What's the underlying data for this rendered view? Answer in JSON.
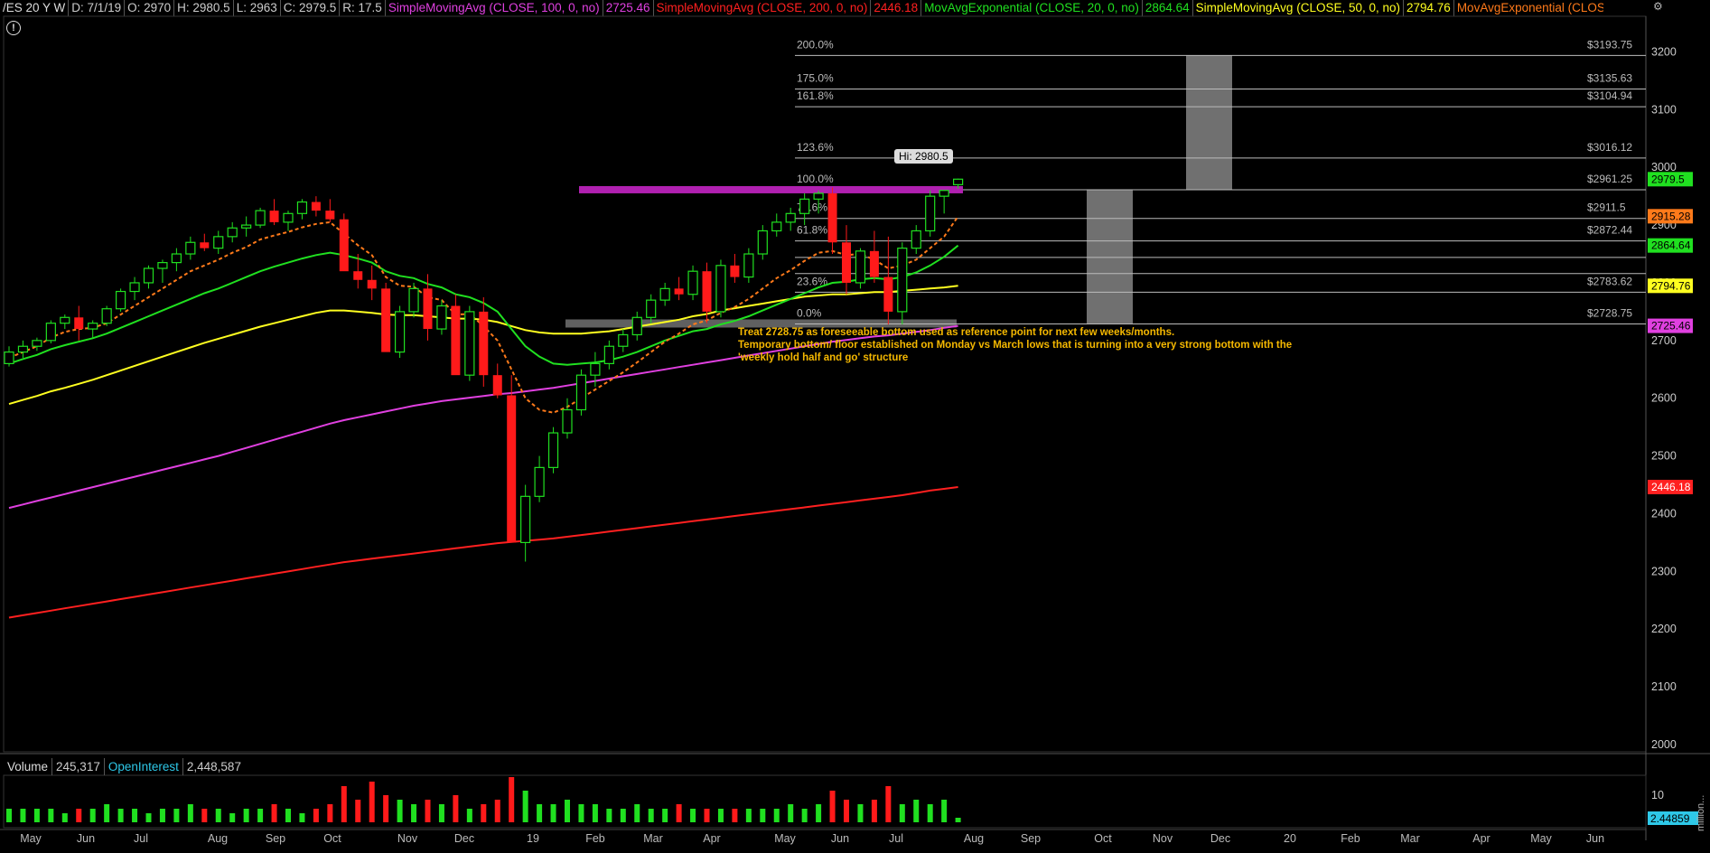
{
  "header": {
    "symbol": "/ES 20 Y W",
    "date": "D: 7/1/19",
    "open": "O: 2970",
    "high": "H: 2980.5",
    "low": "L: 2963",
    "close": "C: 2979.5",
    "range": "R: 17.5",
    "studies": [
      {
        "label": "SimpleMovingAvg (CLOSE, 100, 0, no)",
        "value": "2725.46",
        "color": "#e040e0"
      },
      {
        "label": "SimpleMovingAvg (CLOSE, 200, 0, no)",
        "value": "2446.18",
        "color": "#ff2020"
      },
      {
        "label": "MovAvgExponential (CLOSE, 20, 0, no)",
        "value": "2864.64",
        "color": "#20e020"
      },
      {
        "label": "SimpleMovingAvg (CLOSE, 50, 0, no)",
        "value": "2794.76",
        "color": "#ffff20"
      },
      {
        "label": "MovAvgExponential (CLOSE, 8, 0, no)",
        "value": "2915.28",
        "color": "#ff7a1a"
      }
    ],
    "more": "..."
  },
  "info_icon": "!",
  "corner_icon": "gear-icon",
  "price_axis_labels": [
    "3200",
    "3100",
    "3000",
    "2900",
    "2800",
    "2700",
    "2600",
    "2500",
    "2400",
    "2300",
    "2200",
    "2100",
    "2000"
  ],
  "price_badges": [
    {
      "value": "2979.5",
      "bg": "#20e020",
      "fg": "#000"
    },
    {
      "value": "2915.28",
      "bg": "#ff7a1a",
      "fg": "#000"
    },
    {
      "value": "2864.64",
      "bg": "#20e020",
      "fg": "#000"
    },
    {
      "value": "2794.76",
      "bg": "#ffff20",
      "fg": "#000"
    },
    {
      "value": "2725.46",
      "bg": "#e040e0",
      "fg": "#000"
    },
    {
      "value": "2446.18",
      "bg": "#ff2020",
      "fg": "#fff"
    }
  ],
  "fib_levels": [
    {
      "pct": "200.0%",
      "price": "$3193.75",
      "value": 3193.75
    },
    {
      "pct": "175.0%",
      "price": "$3135.63",
      "value": 3135.63
    },
    {
      "pct": "161.8%",
      "price": "$3104.94",
      "value": 3104.94
    },
    {
      "pct": "123.6%",
      "price": "$3016.12",
      "value": 3016.12
    },
    {
      "pct": "100.0%",
      "price": "$2961.25",
      "value": 2961.25
    },
    {
      "pct": "78.6%",
      "price": "$2911.5",
      "value": 2911.5
    },
    {
      "pct": "61.8%",
      "price": "$2872.44",
      "value": 2872.44
    },
    {
      "pct": "",
      "price": "",
      "value": 2844
    },
    {
      "pct": "",
      "price": "",
      "value": 2816
    },
    {
      "pct": "23.6%",
      "price": "$2783.62",
      "value": 2783.62
    },
    {
      "pct": "0.0%",
      "price": "$2728.75",
      "value": 2728.75
    }
  ],
  "hi_label": "Hi: 2980.5",
  "annotation": "Treat 2728.75 as foreseeable bottom used as reference point for next few weeks/months.\nTemporary bottom/ floor established on Monday vs March lows that is turning into a very strong bottom with the\n'weekly hold half and go' structure",
  "x_axis_labels": [
    "May",
    "Jun",
    "Jul",
    "Aug",
    "Sep",
    "Oct",
    "Nov",
    "Dec",
    "19",
    "Feb",
    "Mar",
    "Apr",
    "May",
    "Jun",
    "Jul",
    "Aug",
    "Sep",
    "Oct",
    "Nov",
    "Dec",
    "20",
    "Feb",
    "Mar",
    "Apr",
    "May",
    "Jun"
  ],
  "volume": {
    "label": "Volume",
    "value": "245,317",
    "oi_label": "OpenInterest",
    "oi_value": "2,448,587",
    "axis_label": "10",
    "badge": "2.44859",
    "units": "million..."
  },
  "chart_data": {
    "type": "candlestick",
    "bars": [
      [
        2660,
        2690,
        2655,
        2680
      ],
      [
        2680,
        2700,
        2670,
        2690
      ],
      [
        2690,
        2705,
        2682,
        2700
      ],
      [
        2700,
        2735,
        2695,
        2730
      ],
      [
        2730,
        2745,
        2720,
        2740
      ],
      [
        2740,
        2760,
        2700,
        2720
      ],
      [
        2720,
        2735,
        2705,
        2730
      ],
      [
        2730,
        2760,
        2725,
        2755
      ],
      [
        2755,
        2790,
        2750,
        2785
      ],
      [
        2785,
        2810,
        2770,
        2800
      ],
      [
        2800,
        2830,
        2790,
        2825
      ],
      [
        2825,
        2840,
        2800,
        2835
      ],
      [
        2835,
        2860,
        2820,
        2850
      ],
      [
        2850,
        2880,
        2840,
        2870
      ],
      [
        2870,
        2885,
        2855,
        2860
      ],
      [
        2860,
        2890,
        2850,
        2880
      ],
      [
        2880,
        2905,
        2870,
        2895
      ],
      [
        2895,
        2915,
        2880,
        2900
      ],
      [
        2900,
        2930,
        2895,
        2925
      ],
      [
        2925,
        2945,
        2900,
        2905
      ],
      [
        2905,
        2925,
        2890,
        2920
      ],
      [
        2920,
        2945,
        2910,
        2940
      ],
      [
        2940,
        2950,
        2915,
        2925
      ],
      [
        2925,
        2945,
        2905,
        2910
      ],
      [
        2910,
        2920,
        2850,
        2820
      ],
      [
        2820,
        2850,
        2790,
        2805
      ],
      [
        2805,
        2830,
        2770,
        2790
      ],
      [
        2790,
        2800,
        2740,
        2680
      ],
      [
        2680,
        2760,
        2670,
        2750
      ],
      [
        2750,
        2800,
        2740,
        2790
      ],
      [
        2790,
        2815,
        2700,
        2720
      ],
      [
        2720,
        2770,
        2710,
        2760
      ],
      [
        2760,
        2780,
        2680,
        2640
      ],
      [
        2640,
        2760,
        2630,
        2750
      ],
      [
        2750,
        2775,
        2620,
        2640
      ],
      [
        2640,
        2660,
        2600,
        2605
      ],
      [
        2605,
        2640,
        2500,
        2350
      ],
      [
        2350,
        2450,
        2317,
        2430
      ],
      [
        2430,
        2500,
        2420,
        2480
      ],
      [
        2480,
        2550,
        2470,
        2540
      ],
      [
        2540,
        2600,
        2530,
        2580
      ],
      [
        2580,
        2650,
        2570,
        2640
      ],
      [
        2640,
        2680,
        2620,
        2660
      ],
      [
        2660,
        2700,
        2650,
        2690
      ],
      [
        2690,
        2720,
        2680,
        2710
      ],
      [
        2710,
        2750,
        2700,
        2740
      ],
      [
        2740,
        2780,
        2730,
        2770
      ],
      [
        2770,
        2800,
        2760,
        2790
      ],
      [
        2790,
        2810,
        2770,
        2780
      ],
      [
        2780,
        2830,
        2770,
        2820
      ],
      [
        2820,
        2835,
        2730,
        2750
      ],
      [
        2750,
        2840,
        2740,
        2830
      ],
      [
        2830,
        2850,
        2800,
        2810
      ],
      [
        2810,
        2860,
        2800,
        2850
      ],
      [
        2850,
        2900,
        2840,
        2890
      ],
      [
        2890,
        2920,
        2880,
        2905
      ],
      [
        2905,
        2930,
        2890,
        2920
      ],
      [
        2920,
        2955,
        2900,
        2945
      ],
      [
        2945,
        2960,
        2920,
        2955
      ],
      [
        2955,
        2965,
        2850,
        2870
      ],
      [
        2870,
        2900,
        2780,
        2800
      ],
      [
        2800,
        2860,
        2790,
        2855
      ],
      [
        2855,
        2890,
        2800,
        2810
      ],
      [
        2810,
        2880,
        2728,
        2750
      ],
      [
        2750,
        2870,
        2728,
        2860
      ],
      [
        2860,
        2900,
        2850,
        2890
      ],
      [
        2890,
        2960,
        2880,
        2950
      ],
      [
        2950,
        2960,
        2920,
        2960
      ],
      [
        2970,
        2980.5,
        2963,
        2979.5
      ]
    ],
    "ema8": [
      2670,
      2680,
      2690,
      2705,
      2715,
      2720,
      2722,
      2730,
      2745,
      2760,
      2775,
      2790,
      2805,
      2820,
      2830,
      2840,
      2852,
      2862,
      2875,
      2882,
      2888,
      2896,
      2902,
      2905,
      2885,
      2865,
      2848,
      2810,
      2795,
      2793,
      2775,
      2770,
      2745,
      2746,
      2725,
      2700,
      2650,
      2600,
      2580,
      2575,
      2585,
      2600,
      2615,
      2630,
      2645,
      2662,
      2680,
      2698,
      2712,
      2728,
      2735,
      2748,
      2758,
      2772,
      2790,
      2808,
      2822,
      2838,
      2852,
      2855,
      2848,
      2850,
      2840,
      2825,
      2830,
      2840,
      2860,
      2880,
      2915
    ],
    "ema20": [
      2660,
      2668,
      2675,
      2685,
      2692,
      2698,
      2704,
      2712,
      2722,
      2732,
      2742,
      2752,
      2762,
      2772,
      2782,
      2790,
      2800,
      2810,
      2820,
      2828,
      2835,
      2842,
      2848,
      2852,
      2848,
      2842,
      2835,
      2820,
      2812,
      2808,
      2798,
      2792,
      2780,
      2775,
      2765,
      2750,
      2720,
      2690,
      2672,
      2660,
      2658,
      2660,
      2662,
      2666,
      2672,
      2680,
      2690,
      2700,
      2708,
      2716,
      2720,
      2728,
      2734,
      2742,
      2752,
      2762,
      2772,
      2782,
      2792,
      2800,
      2802,
      2806,
      2808,
      2806,
      2810,
      2818,
      2830,
      2845,
      2864.64
    ],
    "sma50": [
      2590,
      2597,
      2604,
      2612,
      2618,
      2625,
      2632,
      2640,
      2648,
      2656,
      2664,
      2672,
      2680,
      2688,
      2696,
      2703,
      2710,
      2717,
      2724,
      2730,
      2736,
      2742,
      2748,
      2752,
      2752,
      2750,
      2748,
      2745,
      2744,
      2744,
      2742,
      2740,
      2738,
      2738,
      2736,
      2732,
      2725,
      2718,
      2714,
      2712,
      2712,
      2712,
      2714,
      2716,
      2720,
      2724,
      2728,
      2732,
      2736,
      2742,
      2746,
      2752,
      2756,
      2760,
      2764,
      2768,
      2772,
      2776,
      2778,
      2780,
      2780,
      2782,
      2784,
      2784,
      2786,
      2788,
      2790,
      2792,
      2794.76
    ],
    "sma100": [
      2410,
      2416,
      2422,
      2428,
      2434,
      2440,
      2446,
      2452,
      2458,
      2464,
      2470,
      2476,
      2482,
      2488,
      2494,
      2500,
      2507,
      2514,
      2521,
      2528,
      2535,
      2542,
      2549,
      2556,
      2562,
      2567,
      2572,
      2577,
      2582,
      2587,
      2591,
      2595,
      2598,
      2601,
      2604,
      2607,
      2609,
      2612,
      2615,
      2618,
      2622,
      2626,
      2630,
      2634,
      2638,
      2642,
      2646,
      2650,
      2654,
      2658,
      2662,
      2666,
      2670,
      2674,
      2678,
      2682,
      2686,
      2690,
      2694,
      2698,
      2701,
      2704,
      2707,
      2709,
      2712,
      2715,
      2718,
      2722,
      2725.46
    ],
    "sma200": [
      2220,
      2224,
      2228,
      2232,
      2236,
      2240,
      2244,
      2248,
      2252,
      2256,
      2260,
      2264,
      2268,
      2272,
      2276,
      2280,
      2284,
      2288,
      2292,
      2296,
      2300,
      2304,
      2308,
      2312,
      2316,
      2319,
      2322,
      2325,
      2328,
      2331,
      2334,
      2337,
      2340,
      2343,
      2346,
      2349,
      2351,
      2353,
      2355,
      2357,
      2360,
      2363,
      2366,
      2369,
      2372,
      2375,
      2378,
      2381,
      2384,
      2387,
      2390,
      2393,
      2396,
      2399,
      2402,
      2405,
      2408,
      2411,
      2414,
      2417,
      2420,
      2423,
      2426,
      2429,
      2432,
      2436,
      2440,
      2443,
      2446.18
    ],
    "volume": [
      3,
      3,
      3,
      3,
      2,
      3,
      3,
      4,
      3,
      3,
      2,
      3,
      3,
      4,
      3,
      3,
      2,
      3,
      3,
      4,
      3,
      2,
      3,
      4,
      8,
      5,
      9,
      6,
      5,
      4,
      5,
      4,
      6,
      3,
      4,
      5,
      10,
      7,
      4,
      4,
      5,
      4,
      4,
      3,
      3,
      4,
      3,
      3,
      4,
      3,
      3,
      3,
      3,
      3,
      3,
      3,
      4,
      3,
      4,
      7,
      5,
      4,
      5,
      8,
      4,
      5,
      4,
      5,
      1
    ],
    "ylim": [
      2000,
      3200
    ]
  }
}
